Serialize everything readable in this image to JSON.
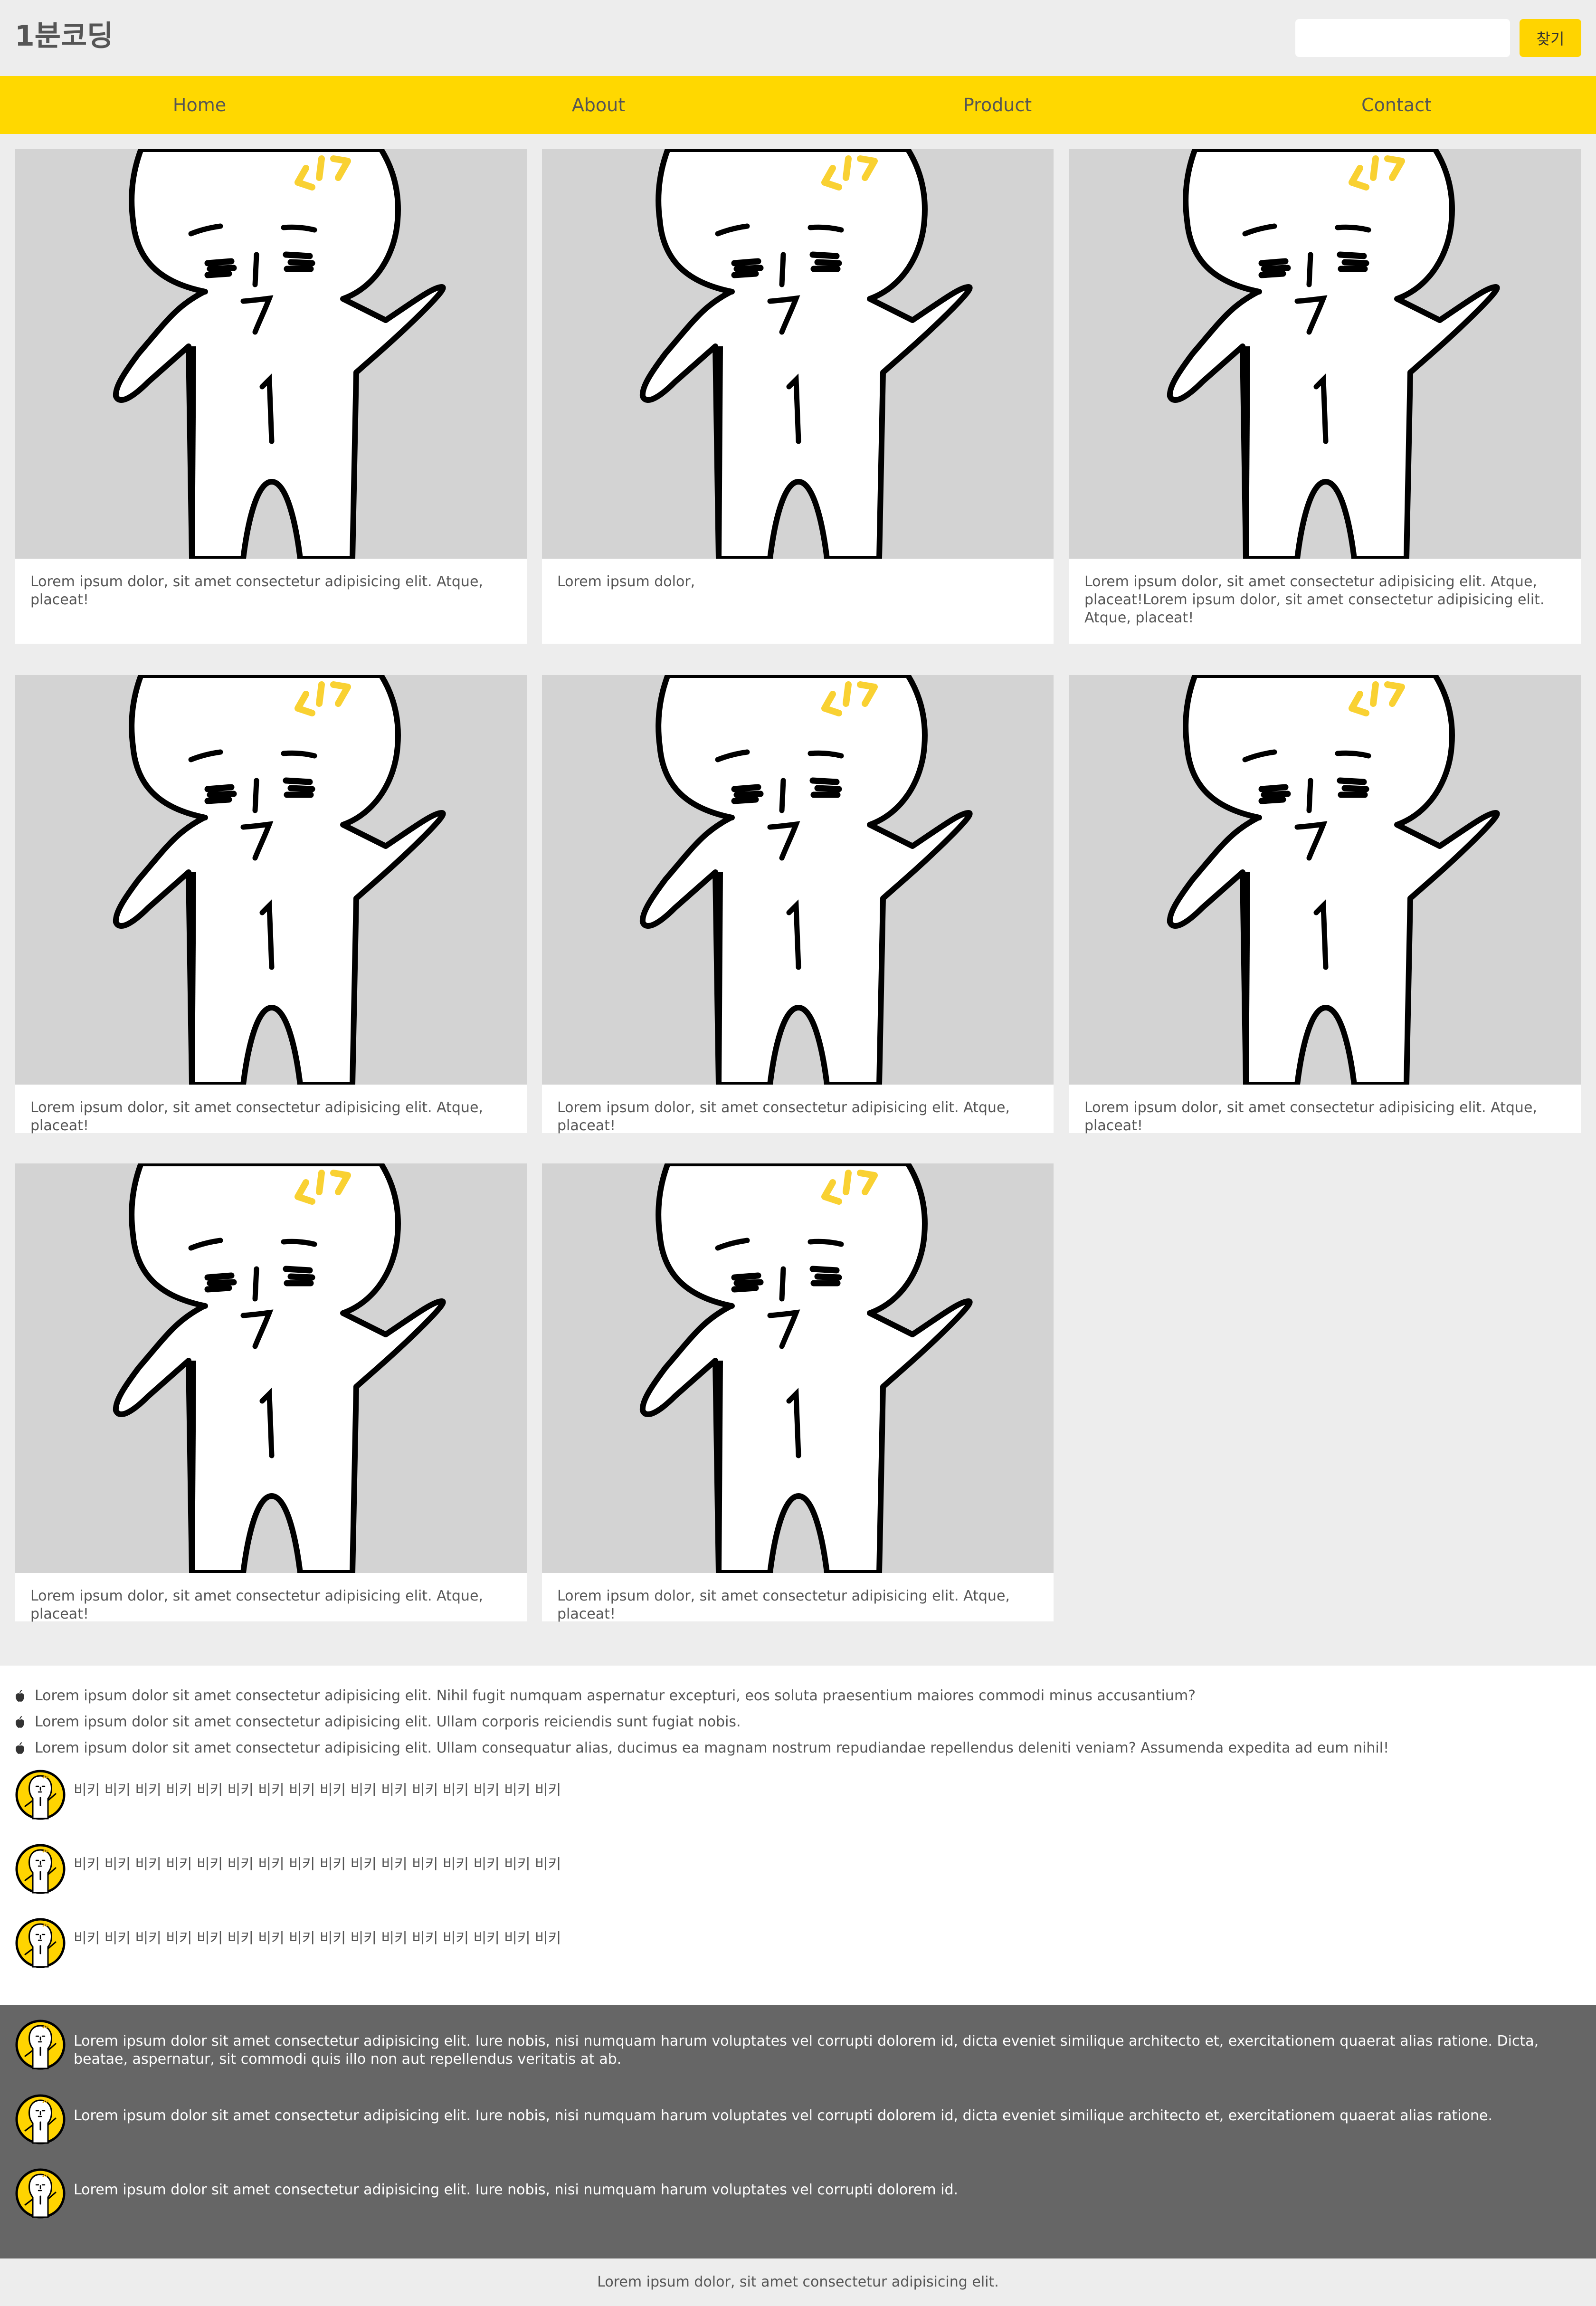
{
  "header": {
    "logo": "1분코딩",
    "search": {
      "value": "",
      "placeholder": ""
    },
    "search_button": "찾기"
  },
  "nav": {
    "items": [
      "Home",
      "About",
      "Product",
      "Contact"
    ]
  },
  "cards": [
    {
      "text": "Lorem ipsum dolor, sit amet consectetur adipisicing elit. Atque, placeat!"
    },
    {
      "text": "Lorem ipsum dolor,"
    },
    {
      "text": "Lorem ipsum dolor, sit amet consectetur adipisicing elit. Atque, placeat!Lorem ipsum dolor, sit amet consectetur adipisicing elit. Atque, placeat!"
    },
    {
      "text": "Lorem ipsum dolor, sit amet consectetur adipisicing elit. Atque, placeat!"
    },
    {
      "text": "Lorem ipsum dolor, sit amet consectetur adipisicing elit. Atque, placeat!"
    },
    {
      "text": "Lorem ipsum dolor, sit amet consectetur adipisicing elit. Atque, placeat!"
    },
    {
      "text": "Lorem ipsum dolor, sit amet consectetur adipisicing elit. Atque, placeat!"
    },
    {
      "text": "Lorem ipsum dolor, sit amet consectetur adipisicing elit. Atque, placeat!"
    }
  ],
  "bullets": [
    "Lorem ipsum dolor sit amet consectetur adipisicing elit. Nihil fugit numquam aspernatur excepturi, eos soluta praesentium maiores commodi minus accusantium?",
    "Lorem ipsum dolor sit amet consectetur adipisicing elit. Ullam corporis reiciendis sunt fugiat nobis.",
    "Lorem ipsum dolor sit amet consectetur adipisicing elit. Ullam consequatur alias, ducimus ea magnam nostrum repudiandae repellendus deleniti veniam? Assumenda expedita ad eum nihil!"
  ],
  "avatar_items": [
    "비키 비키 비키 비키 비키 비키 비키 비키 비키 비키 비키 비키 비키 비키 비키 비키",
    "비키 비키 비키 비키 비키 비키 비키 비키 비키 비키 비키 비키 비키 비키 비키 비키",
    "비키 비키 비키 비키 비키 비키 비키 비키 비키 비키 비키 비키 비키 비키 비키 비키"
  ],
  "dark_items": [
    "Lorem ipsum dolor sit amet consectetur adipisicing elit. Iure nobis, nisi numquam harum voluptates vel corrupti dolorem id, dicta eveniet similique architecto et, exercitationem quaerat alias ratione. Dicta, beatae, aspernatur, sit commodi quis illo non aut repellendus veritatis at ab.",
    "Lorem ipsum dolor sit amet consectetur adipisicing elit. Iure nobis, nisi numquam harum voluptates vel corrupti dolorem id, dicta eveniet similique architecto et, exercitationem quaerat alias ratione.",
    "Lorem ipsum dolor sit amet consectetur adipisicing elit. Iure nobis, nisi numquam harum voluptates vel corrupti dolorem id."
  ],
  "footer": {
    "text": "Lorem ipsum dolor, sit amet consectetur adipisicing elit."
  },
  "colors": {
    "accent": "#ffd800",
    "background": "#ededed",
    "dark": "#666666"
  },
  "icons": {
    "card_image": "character-illustration",
    "bullet": "apple-icon",
    "avatar": "character-avatar"
  }
}
